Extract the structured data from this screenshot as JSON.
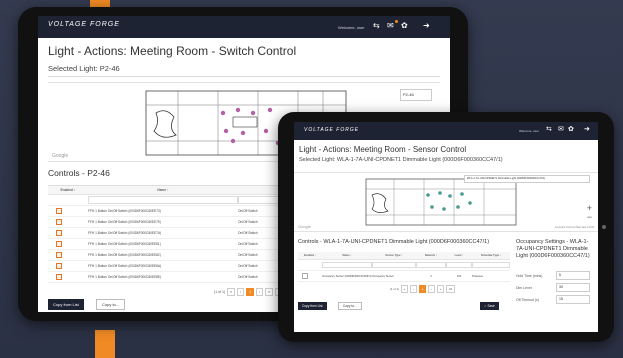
{
  "back_tablet": {
    "app_logo": "VOLTAGE FORGE",
    "welcome_text": "Welcome, user",
    "title": "Light - Actions: Meeting Room - Switch Control",
    "selected_light": "Selected Light: P2-46",
    "map_select_value": "P2-46",
    "map_brand": "Google",
    "controls_title": "Controls - P2-46",
    "columns": [
      "Enabled ↕",
      "Name ↕",
      "Device Type ↕",
      "Bound"
    ],
    "rows": [
      {
        "name": "FFH 1 Button On/Off Switch (000D6F000C80EE73)",
        "type": "On/Off Switch"
      },
      {
        "name": "FFH 1 Button On/Off Switch (000D6F000C80EE79)",
        "type": "On/Off Switch"
      },
      {
        "name": "FFH 1 Button On/Off Switch (000D6F000C80EE7A)",
        "type": "On/Off Switch"
      },
      {
        "name": "FFH 1 Button On/Off Switch (000D6F000C80EE81)",
        "type": "On/Off Switch"
      },
      {
        "name": "FFH 1 Button On/Off Switch (000D6F000C80EE82)",
        "type": "On/Off Switch"
      },
      {
        "name": "FFH 1 Button On/Off Switch (000D6F000C80EE8A)",
        "type": "On/Off Switch"
      },
      {
        "name": "FFH 1 Button On/Off Switch (000D6F000C80EE8E)",
        "type": "On/Off Switch"
      }
    ],
    "pager_text": "(1 of 1)",
    "pager_pages": [
      "«",
      "‹",
      "1",
      "›",
      "»"
    ],
    "page_size": "10",
    "copy_button": "Copy from List",
    "copy_to_select": "Copy to..."
  },
  "front_tablet": {
    "app_logo": "VOLTAGE FORGE",
    "welcome_text": "Welcome, user",
    "title": "Light - Actions: Meeting Room - Sensor Control",
    "selected_light": "Selected Light: WLA-1-7A-UNI-CPDNET1 Dimmable Light (000D6F000360CC47/1)",
    "map_select_value": "WLA-1-7A-UNI-CPDNET1 Dimmable Light (000D6F000360CC47/1)",
    "map_brand": "Google",
    "map_footer": "Keyboard shortcuts   Map data ©2019",
    "controls_title": "Controls - WLA-1-7A-UNI-CPDNET1 Dimmable Light (000D6F000360CC47/1)",
    "columns": [
      "Enabled ↕",
      "Name ↕",
      "Device Type ↕",
      "Network ↕",
      "Level ↕",
      "Schedule Type ↕"
    ],
    "row": {
      "name": "Occupancy Sensor (000D6F000C6CD9F4)",
      "type": "Occupancy Sensor",
      "network": "3",
      "level": "100",
      "schedule": "Presence"
    },
    "pager_text": "(1 of 1)",
    "page_size": "10",
    "copy_button": "Copy from List",
    "copy_to_select": "Copy to...",
    "save_button": "✓ Save",
    "occupancy_title": "Occupancy Settings - WLA-1-7A-UNI-CPDNET1 Dimmable Light (000D6F000360CC47/1)",
    "occupancy_fields": [
      {
        "label": "Hold Time (mins)",
        "value": "5"
      },
      {
        "label": "Dim Level",
        "value": "30"
      },
      {
        "label": "Off Timeout (s)",
        "value": "15"
      }
    ]
  },
  "colors": {
    "accent": "#f08a24",
    "navbar": "#1e2334",
    "background": "#2d3346"
  }
}
